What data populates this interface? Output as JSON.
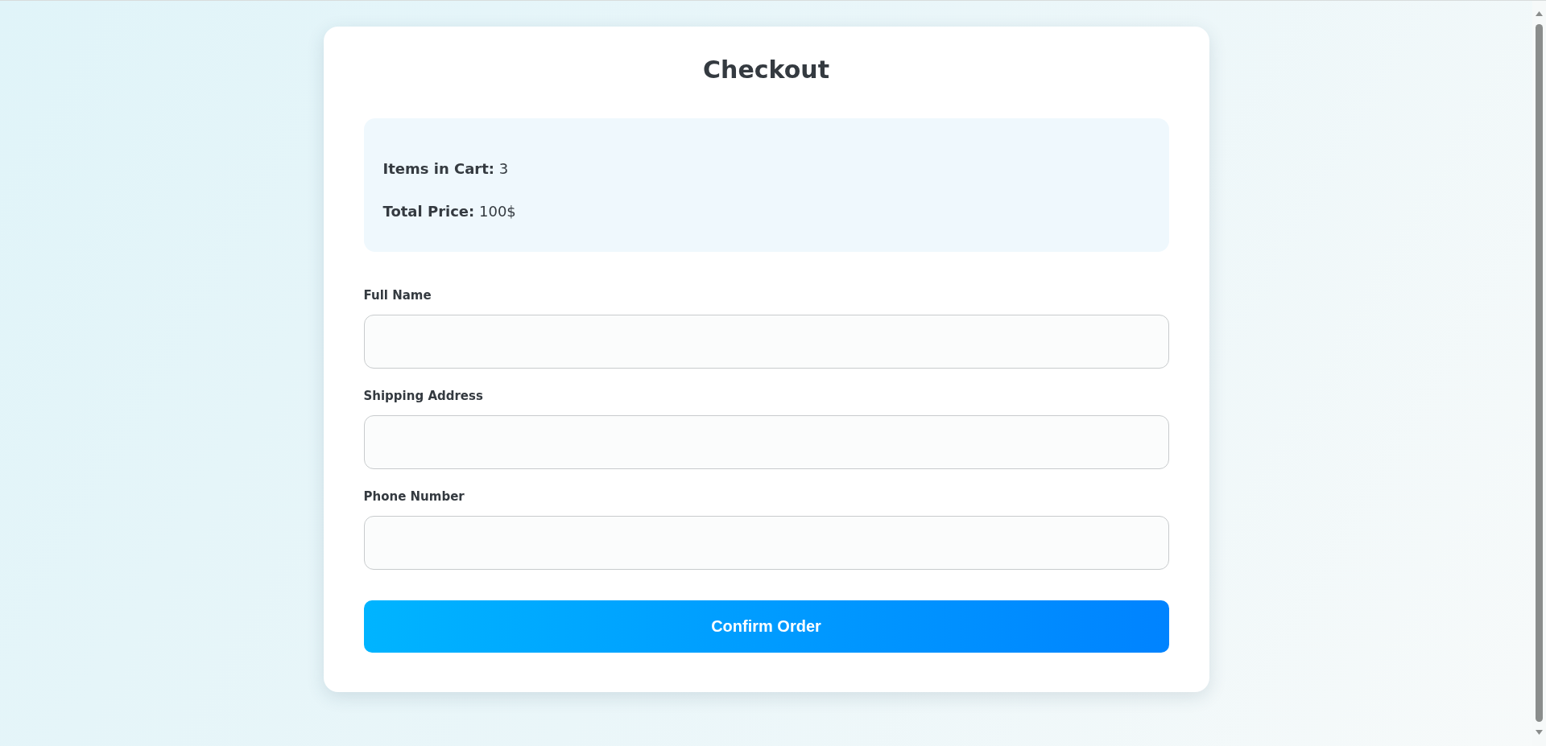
{
  "title": "Checkout",
  "summary": [
    "**Items in Cart:** 3",
    "**Total Price:** 100$"
  ],
  "fields": [
    {
      "label": "Full Name"
    },
    {
      "label": "Shipping Address"
    },
    {
      "label": "Phone Number"
    }
  ],
  "button": "Confirm Order"
}
